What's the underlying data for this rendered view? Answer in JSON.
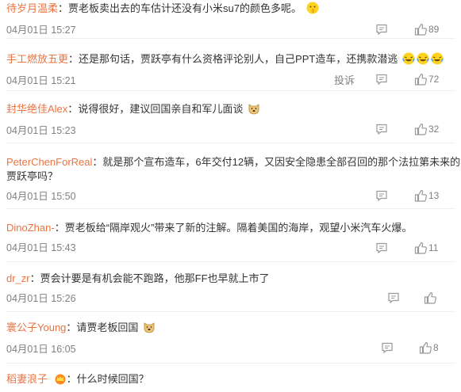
{
  "comments": [
    {
      "user": "待岁月温柔",
      "sep": "：",
      "text": "贾老板卖出去的车估计还没有小米su7的颜色多呢。",
      "time": "04月01日 15:27",
      "likes": "89",
      "emojis": [
        "shush"
      ]
    },
    {
      "user": "手工燃放五更",
      "sep": "：",
      "text": "还是那句话，贾跃亭有什么资格评论别人，自己PPT造车，还携款潜逃",
      "time": "04月01日 15:21",
      "likes": "72",
      "report": "投诉",
      "emojis": [
        "laugh-cry",
        "laugh-cry",
        "laugh-cry"
      ]
    },
    {
      "user": "封华绝佳Alex",
      "sep": "：",
      "text": "说得很好，建议回国亲自和军儿面谈",
      "time": "04月01日 15:23",
      "likes": "32",
      "emojis": [
        "doge"
      ]
    },
    {
      "user": "PeterChenForReal",
      "sep": "：",
      "text": "就是那个宣布造车，6年交付12辆，又因安全隐患全部召回的那个法拉第未来的老板",
      "text2": "贾跃亭吗？",
      "time": "04月01日 15:50",
      "likes": "13",
      "emojis": []
    },
    {
      "user": "DinoZhan-",
      "sep": "：",
      "text": "贾老板给“隔岸观火”带来了新的注解。隔着美国的海岸，观望小米汽车火爆。",
      "time": "04月01日 15:43",
      "likes": "11",
      "emojis": []
    },
    {
      "user": "dr_zr",
      "sep": "：",
      "text": "贾会计要是有机会能不跑路，他那FF也早就上市了",
      "time": "04月01日 15:26",
      "likes": "",
      "emojis": []
    },
    {
      "user": "寰公子Young",
      "sep": "：",
      "text": "请贾老板回国",
      "time": "04月01日 16:05",
      "likes": "8",
      "emojis": [
        "doge"
      ]
    },
    {
      "user": "稻妻浪子",
      "sep": "：",
      "text": "什么时候回国？",
      "time": "",
      "likes": "",
      "emojis": [],
      "badge": "crown-icon"
    }
  ]
}
